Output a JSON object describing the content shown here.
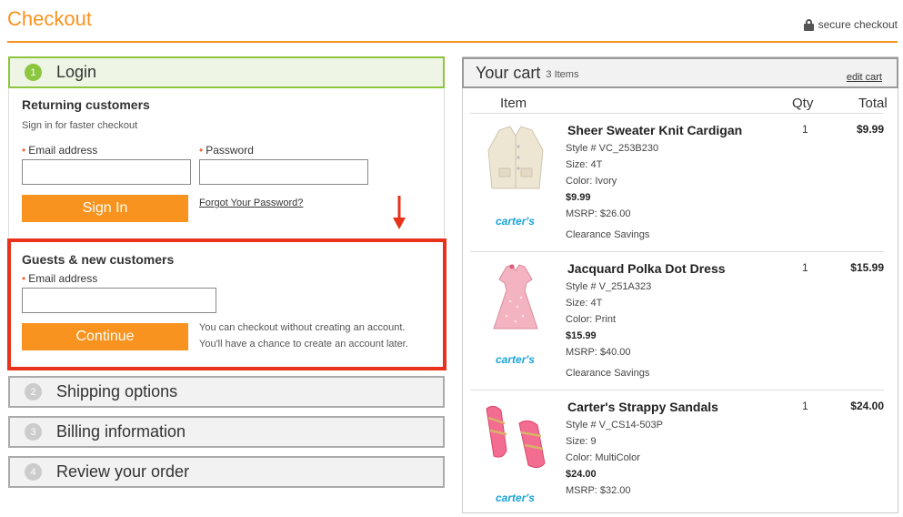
{
  "header": {
    "title": "Checkout",
    "secure_label": "secure checkout"
  },
  "steps": [
    {
      "num": "1",
      "label": "Login"
    },
    {
      "num": "2",
      "label": "Shipping options"
    },
    {
      "num": "3",
      "label": "Billing information"
    },
    {
      "num": "4",
      "label": "Review your order"
    }
  ],
  "login": {
    "heading": "Returning customers",
    "subtext": "Sign in for faster checkout",
    "email_label": "Email address",
    "password_label": "Password",
    "email_value": "",
    "password_value": "",
    "signin_label": "Sign In",
    "forgot_label": "Forgot Your Password?"
  },
  "guest": {
    "heading": "Guests & new customers",
    "email_label": "Email address",
    "email_value": "",
    "continue_label": "Continue",
    "note_line1": "You can checkout without creating an account.",
    "note_line2": "You'll have a chance to create an account later."
  },
  "cart": {
    "title": "Your cart",
    "count": "3 Items",
    "edit_label": "edit cart",
    "col_item": "Item",
    "col_qty": "Qty",
    "col_total": "Total",
    "items": [
      {
        "name": "Sheer Sweater Knit Cardigan",
        "style": "Style # VC_253B230",
        "size": "Size: 4T",
        "color": "Color: Ivory",
        "price": "$9.99",
        "msrp": "MSRP: $26.00",
        "note": "Clearance Savings",
        "qty": "1",
        "total": "$9.99",
        "brand": "carter's"
      },
      {
        "name": "Jacquard Polka Dot Dress",
        "style": "Style # V_251A323",
        "size": "Size: 4T",
        "color": "Color: Print",
        "price": "$15.99",
        "msrp": "MSRP: $40.00",
        "note": "Clearance Savings",
        "qty": "1",
        "total": "$15.99",
        "brand": "carter's"
      },
      {
        "name": "Carter's Strappy Sandals",
        "style": "Style # V_CS14-503P",
        "size": "Size: 9",
        "color": "Color: MultiColor",
        "price": "$24.00",
        "msrp": "MSRP: $32.00",
        "qty": "1",
        "total": "$24.00",
        "brand": "carter's"
      }
    ]
  },
  "colors": {
    "accent": "#f7931e",
    "active_step": "#8cc63f",
    "highlight": "#e8321c",
    "brand": "#1aa3d9"
  }
}
